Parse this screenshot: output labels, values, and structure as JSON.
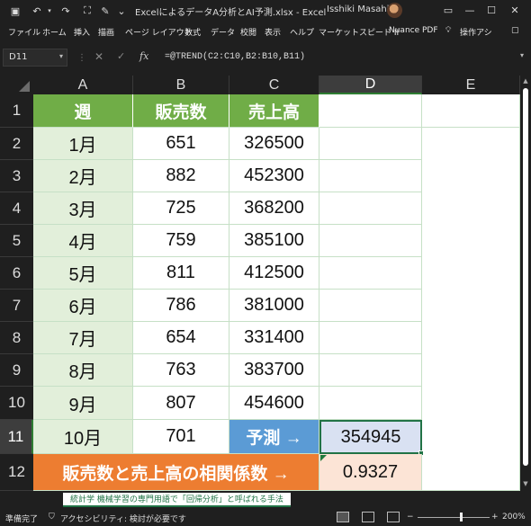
{
  "titlebar": {
    "title": "ExcelによるデータA分析とAI予測.xlsx  -  Excel",
    "user": "Isshiki Masahiko"
  },
  "ribbon_tabs": [
    "ファイル",
    "ホーム",
    "挿入",
    "描画",
    "ページ レイアウト",
    "数式",
    "データ",
    "校閲",
    "表示",
    "ヘルプ",
    "マーケットスピード II",
    "Nuance PDF",
    "操作アシ"
  ],
  "formula_bar": {
    "name_box": "D11",
    "formula": "=@TREND(C2:C10,B2:B10,B11)"
  },
  "columns": [
    "A",
    "B",
    "C",
    "D",
    "E"
  ],
  "rows": [
    "1",
    "2",
    "3",
    "4",
    "5",
    "6",
    "7",
    "8",
    "9",
    "10",
    "11",
    "12"
  ],
  "table": {
    "headers": [
      "週",
      "販売数",
      "売上高"
    ],
    "data": [
      [
        "1月",
        "651",
        "326500"
      ],
      [
        "2月",
        "882",
        "452300"
      ],
      [
        "3月",
        "725",
        "368200"
      ],
      [
        "4月",
        "759",
        "385100"
      ],
      [
        "5月",
        "811",
        "412500"
      ],
      [
        "6月",
        "786",
        "381000"
      ],
      [
        "7月",
        "654",
        "331400"
      ],
      [
        "8月",
        "763",
        "383700"
      ],
      [
        "9月",
        "807",
        "454600"
      ]
    ],
    "row11": [
      "10月",
      "701"
    ],
    "prediction_label": "予測 →",
    "prediction_value": "354945",
    "correlation_label": "販売数と売上高の相関係数 →",
    "correlation_value": "0.9327"
  },
  "sheet_tab": "統計学 機械学習の専門用語で「回帰分析」と呼ばれる手法",
  "status": {
    "ready": "準備完了",
    "accessibility": "アクセシビリティ: 検討が必要です",
    "zoom": "200%"
  },
  "colors": {
    "header_green": "#70ad47",
    "week_fill": "#e2efda",
    "predict_blue": "#5b9bd5",
    "predict_value_fill": "#d9e1f2",
    "correlation_orange": "#ed7d31",
    "correlation_value_fill": "#fce4d6"
  }
}
